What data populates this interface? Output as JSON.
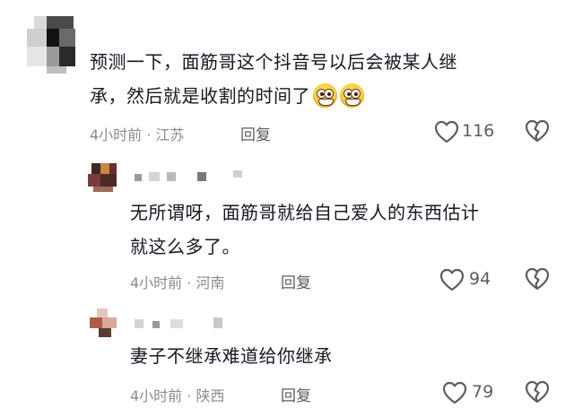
{
  "comments": [
    {
      "text_line1": "预测一下，面筋哥这个抖音号以后会被某人继",
      "text_line2": "承，然后就是收割的时间了",
      "emoji_icons": [
        "grinning-face-icon",
        "grinning-face-icon"
      ],
      "meta": "4小时前 · 江苏",
      "reply_label": "回复",
      "likes": "116"
    },
    {
      "text_line1": "无所谓呀，面筋哥就给自己爱人的东西估计",
      "text_line2": "就这么多了。",
      "meta": "4小时前 · 河南",
      "reply_label": "回复",
      "likes": "94"
    },
    {
      "text_line1": "妻子不继承难道给你继承",
      "meta": "4小时前 · 陕西",
      "reply_label": "回复",
      "likes": "79"
    }
  ],
  "icons": {
    "like": "heart-outline-icon",
    "dislike": "broken-heart-icon",
    "avatar": "avatar-pixelated"
  },
  "colors": {
    "text": "#161823",
    "meta": "#8a8b91",
    "icon": "#5c5d63"
  }
}
